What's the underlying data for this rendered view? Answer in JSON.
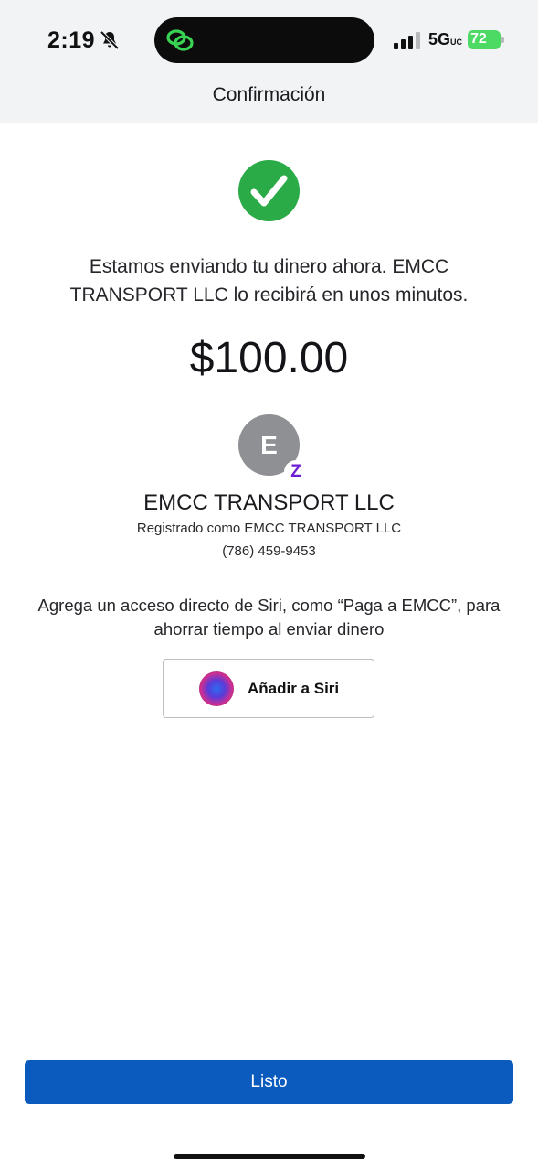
{
  "status_bar": {
    "time": "2:19",
    "network": "5G",
    "network_superscript": "UC",
    "battery_percent": "72",
    "icons": [
      "bell-slash-icon",
      "cellular-signal-icon",
      "battery-charging-icon",
      "app-activity-icon"
    ]
  },
  "header": {
    "title": "Confirmación"
  },
  "confirmation": {
    "message": "Estamos enviando tu dinero ahora. EMCC TRANSPORT LLC lo recibirá en unos minutos.",
    "amount": "$100.00"
  },
  "recipient": {
    "initial": "E",
    "badge": "Z",
    "name": "EMCC TRANSPORT LLC",
    "registered_as": "Registrado como EMCC TRANSPORT LLC",
    "phone": "(786) 459-9453"
  },
  "siri": {
    "hint": "Agrega un acceso directo de Siri, como “Paga a EMCC”, para ahorrar tiempo al enviar dinero",
    "button_label": "Añadir a Siri"
  },
  "footer": {
    "done_label": "Listo"
  },
  "colors": {
    "primary_button": "#0a5bbd",
    "success": "#2bab48",
    "zelle": "#6d1ed4",
    "avatar": "#8f9094"
  }
}
